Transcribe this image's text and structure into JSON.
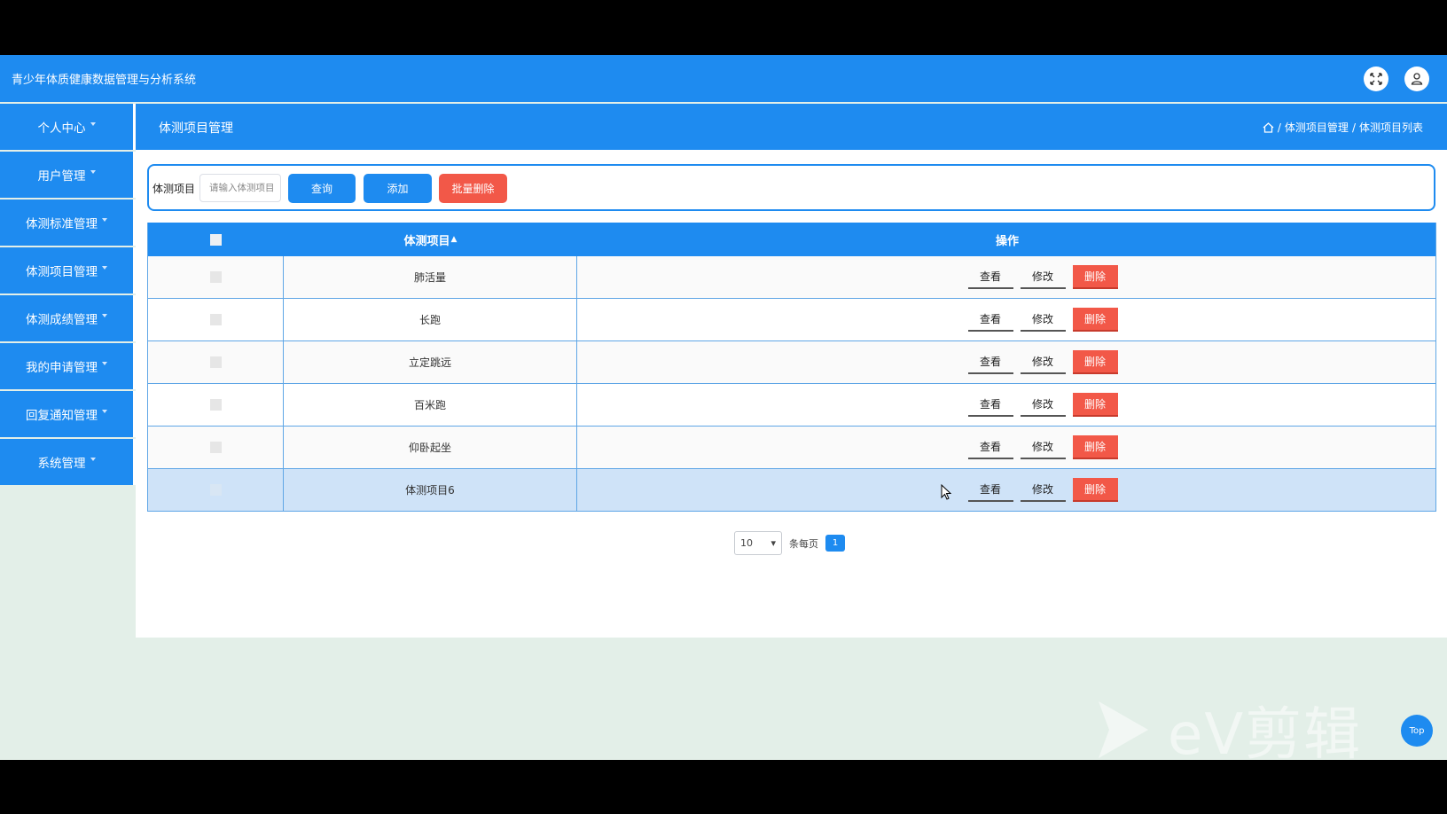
{
  "header": {
    "app_title": "青少年体质健康数据管理与分析系统",
    "icons": [
      "fullscreen-icon",
      "user-icon"
    ]
  },
  "sidebar": {
    "items": [
      {
        "label": "个人中心"
      },
      {
        "label": "用户管理"
      },
      {
        "label": "体测标准管理"
      },
      {
        "label": "体测项目管理"
      },
      {
        "label": "体测成绩管理"
      },
      {
        "label": "我的申请管理"
      },
      {
        "label": "回复通知管理"
      },
      {
        "label": "系统管理"
      }
    ]
  },
  "page": {
    "title": "体测项目管理",
    "breadcrumb": [
      "体测项目管理",
      "体测项目列表"
    ],
    "breadcrumb_sep": "/"
  },
  "search": {
    "label": "体测项目",
    "placeholder": "请输入体测项目",
    "query_label": "查询",
    "add_label": "添加",
    "batch_delete_label": "批量删除"
  },
  "table": {
    "headers": {
      "name": "体测项目",
      "actions": "操作"
    },
    "action_labels": {
      "view": "查看",
      "edit": "修改",
      "delete": "删除"
    },
    "rows": [
      {
        "name": "肺活量"
      },
      {
        "name": "长跑"
      },
      {
        "name": "立定跳远"
      },
      {
        "name": "百米跑"
      },
      {
        "name": "仰卧起坐"
      },
      {
        "name": "体测项目6"
      }
    ]
  },
  "pagination": {
    "page_size": "10",
    "per_page_label": "条每页",
    "current_page": "1"
  },
  "watermark": {
    "text": "eV剪辑"
  },
  "back_to_top": {
    "label": "Top"
  },
  "colors": {
    "primary": "#1e8bf0",
    "danger": "#f25848",
    "background": "#e3efe8",
    "row_highlight": "#cfe3f8"
  }
}
